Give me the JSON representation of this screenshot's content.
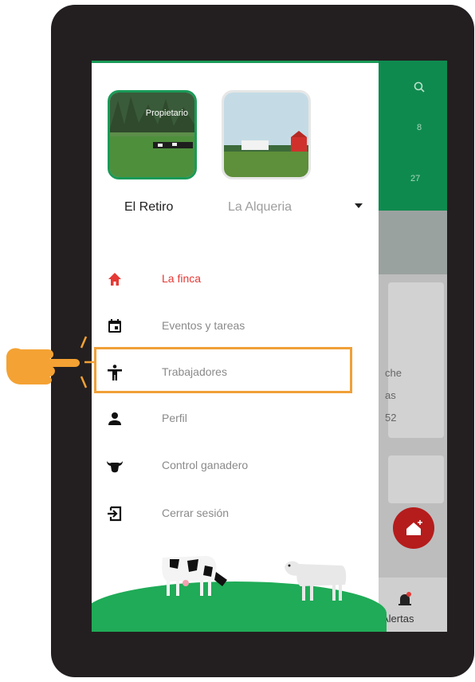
{
  "farms": [
    {
      "name": "El Retiro",
      "badge": "Propietario",
      "selected": true
    },
    {
      "name": "La Alqueria",
      "selected": false
    }
  ],
  "menu": [
    {
      "label": "La finca",
      "icon": "home-icon",
      "active": true
    },
    {
      "label": "Eventos y tareas",
      "icon": "calendar-icon",
      "active": false
    },
    {
      "label": "Trabajadores",
      "icon": "worker-icon",
      "active": false
    },
    {
      "label": "Perfil",
      "icon": "person-icon",
      "active": false
    },
    {
      "label": "Control ganadero",
      "icon": "cow-head-icon",
      "active": false
    },
    {
      "label": "Cerrar sesión",
      "icon": "logout-icon",
      "active": false
    }
  ],
  "background": {
    "header_number_1": "8",
    "header_number_2": "27",
    "card_text_1": "che",
    "card_text_2": "as",
    "card_text_3": "52",
    "nav_alerts": "Alertas"
  },
  "colors": {
    "brand_green": "#1a9a57",
    "active_red": "#e53935",
    "highlight_orange": "#f0a037"
  }
}
